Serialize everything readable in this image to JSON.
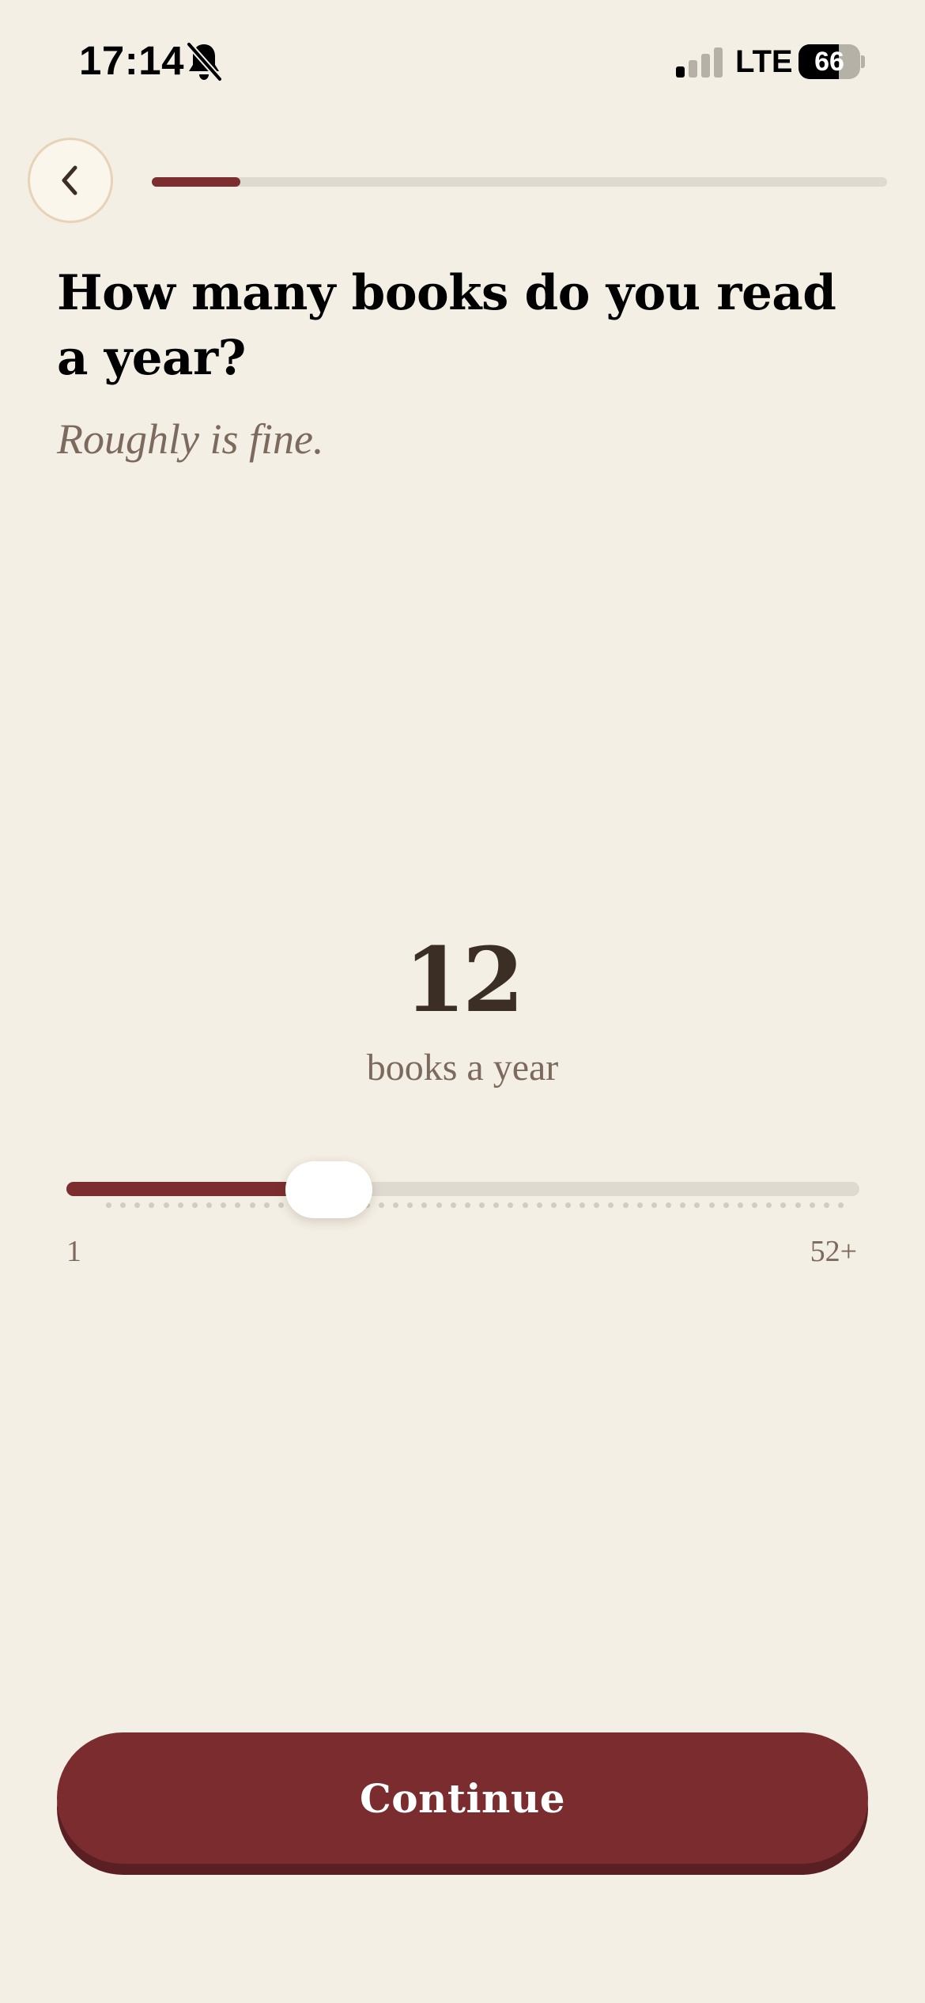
{
  "status_bar": {
    "time": "17:14",
    "network": "LTE",
    "battery_level": "66",
    "battery_fraction": 0.66,
    "signal_strength_bars": 1,
    "signal_total_bars": 4,
    "icons": [
      "bell-off-icon",
      "signal-icon",
      "battery-icon"
    ]
  },
  "navigation": {
    "back_icon": "chevron-left-icon",
    "progress_fraction": 0.12
  },
  "question": {
    "title": "How many books do you read a year?",
    "subtitle": "Roughly is fine."
  },
  "selection": {
    "value": "12",
    "unit_label": "books a year"
  },
  "slider": {
    "min_label": "1",
    "max_label": "52+",
    "min_value": 1,
    "max_value": 52,
    "current_value": 12,
    "tick_count": 52
  },
  "actions": {
    "continue_label": "Continue"
  },
  "colors": {
    "background": "#F4EFE4",
    "accent": "#7C2D30",
    "track": "#DFDAD0",
    "muted_text": "#7B6A5D",
    "value_text": "#3A2E25"
  }
}
